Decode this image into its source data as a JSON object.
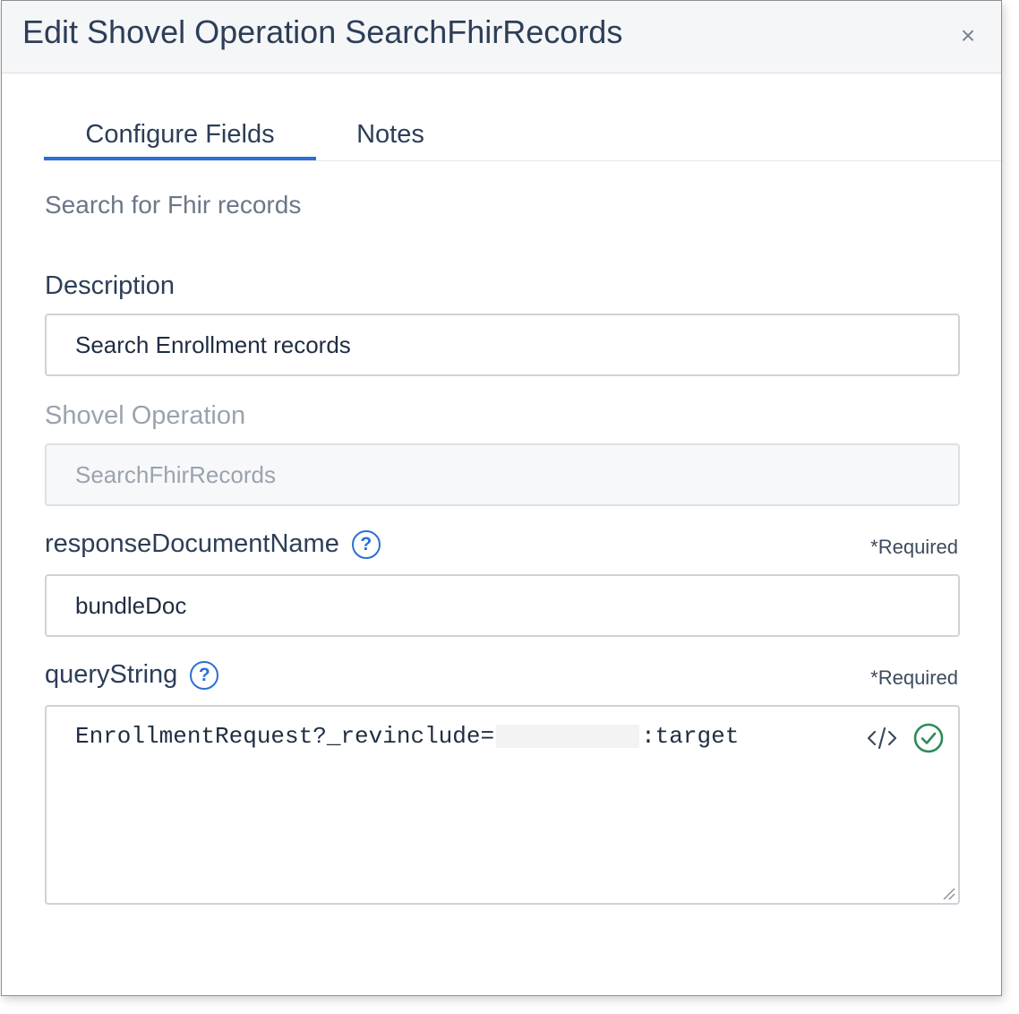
{
  "dialog": {
    "title": "Edit Shovel Operation SearchFhirRecords",
    "close_symbol": "×"
  },
  "tabs": [
    {
      "label": "Configure Fields",
      "active": true
    },
    {
      "label": "Notes",
      "active": false
    }
  ],
  "subtitle": "Search for Fhir records",
  "fields": {
    "description": {
      "label": "Description",
      "value": "Search Enrollment records"
    },
    "shovel_operation": {
      "label": "Shovel Operation",
      "value": "SearchFhirRecords",
      "disabled": true
    },
    "response_document_name": {
      "label": "responseDocumentName",
      "required": "*Required",
      "value": "bundleDoc"
    },
    "query_string": {
      "label": "queryString",
      "required": "*Required",
      "value_prefix": "EnrollmentRequest?_revinclude=",
      "value_suffix": ":target"
    }
  },
  "icons": {
    "help": "question-circle-icon",
    "code": "code-icon",
    "valid": "check-circle-icon",
    "close": "close-icon"
  },
  "colors": {
    "accent": "#2b6fd6",
    "success": "#2e8b57"
  }
}
